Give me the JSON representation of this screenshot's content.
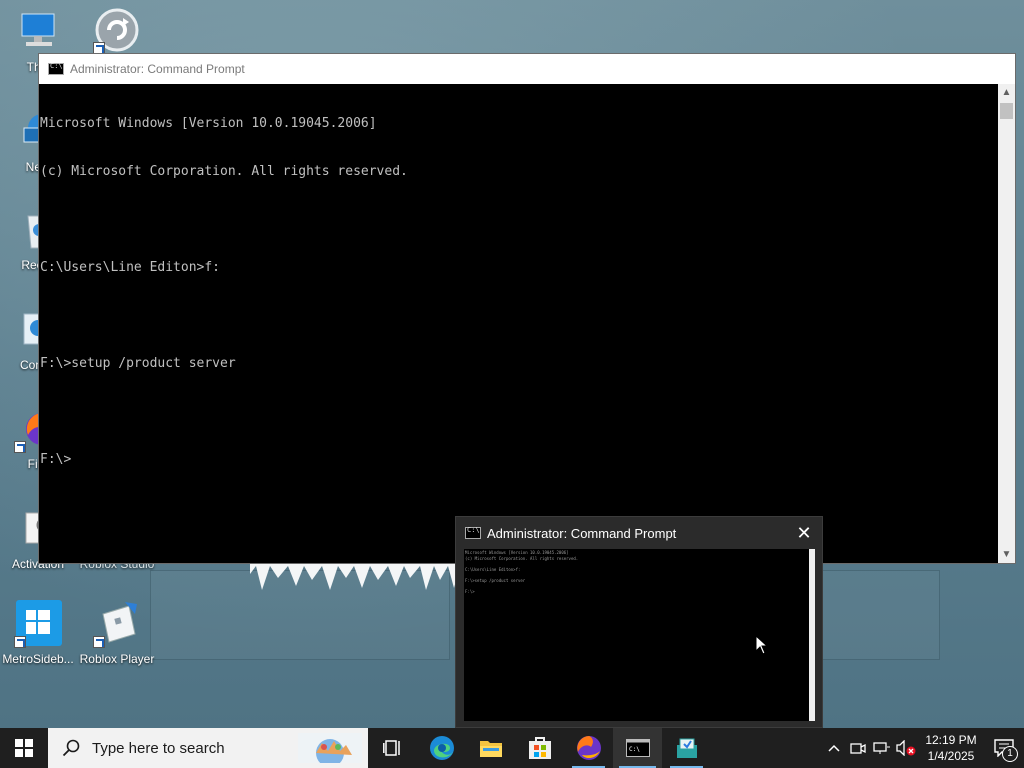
{
  "desktop": {
    "icons": [
      {
        "label": "This",
        "icon": "this-pc-icon"
      },
      {
        "label": "",
        "icon": "update-icon"
      },
      {
        "label": "Netv",
        "icon": "network-icon"
      },
      {
        "label": "Recyc",
        "icon": "recycle-bin-icon"
      },
      {
        "label": "Contro",
        "icon": "control-panel-icon"
      },
      {
        "label": "Fire",
        "icon": "firefox-icon"
      },
      {
        "label": "Activation",
        "icon": "activation-icon"
      },
      {
        "label": "Roblox Studio",
        "icon": "roblox-studio-icon"
      },
      {
        "label": "MetroSideb...",
        "icon": "metrosidebar-icon"
      },
      {
        "label": "Roblox Player",
        "icon": "roblox-player-icon"
      }
    ]
  },
  "cmd_window": {
    "title": "Administrator: Command Prompt",
    "lines": [
      "Microsoft Windows [Version 10.0.19045.2006]",
      "(c) Microsoft Corporation. All rights reserved.",
      "",
      "C:\\Users\\Line Editon>f:",
      "",
      "F:\\>setup /product server",
      "",
      "F:\\>"
    ]
  },
  "preview": {
    "title": "Administrator: Command Prompt",
    "close_label": "✕"
  },
  "taskbar": {
    "search_placeholder": "Type here to search",
    "apps": [
      "Task View",
      "Microsoft Edge",
      "File Explorer",
      "Microsoft Store",
      "Firefox",
      "Command Prompt",
      "Windows Sandbox"
    ],
    "clock_time": "12:19 PM",
    "clock_date": "1/4/2025",
    "notification_count": "1"
  },
  "colors": {
    "taskbar_bg": "#1f1f1f",
    "accent": "#76b9ed",
    "console_text": "#c0c0c0"
  }
}
